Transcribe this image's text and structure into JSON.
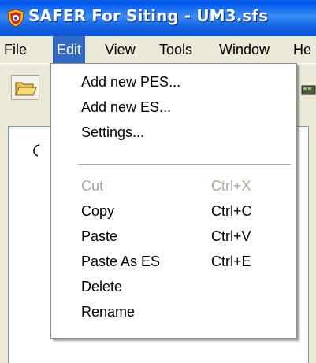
{
  "window": {
    "title": "SAFER For Siting - UM3.sfs",
    "app_icon": "shield-icon"
  },
  "menubar": {
    "items": [
      {
        "label": "File"
      },
      {
        "label": "Edit",
        "active": true
      },
      {
        "label": "View"
      },
      {
        "label": "Tools"
      },
      {
        "label": "Window"
      },
      {
        "label": "He"
      }
    ]
  },
  "toolbar": {
    "icons": [
      "open-folder-icon",
      "toolbar-partial-icon"
    ]
  },
  "edit_menu": {
    "items": [
      {
        "label": "Add new PES...",
        "shortcut": "",
        "enabled": true
      },
      {
        "label": "Add new ES...",
        "shortcut": "",
        "enabled": true
      },
      {
        "label": "Settings...",
        "shortcut": "",
        "enabled": true
      },
      {
        "label": "Cut",
        "shortcut": "Ctrl+X",
        "enabled": false
      },
      {
        "label": "Copy",
        "shortcut": "Ctrl+C",
        "enabled": true
      },
      {
        "label": "Paste",
        "shortcut": "Ctrl+V",
        "enabled": true
      },
      {
        "label": "Paste As ES",
        "shortcut": "Ctrl+E",
        "enabled": true
      },
      {
        "label": "Delete",
        "shortcut": "",
        "enabled": true
      },
      {
        "label": "Rename",
        "shortcut": "",
        "enabled": true
      }
    ]
  },
  "colors": {
    "titlebar": "#0a55d6",
    "menu_highlight": "#316ac5",
    "disabled_text": "#aca899",
    "window_bg": "#ece9d8"
  }
}
